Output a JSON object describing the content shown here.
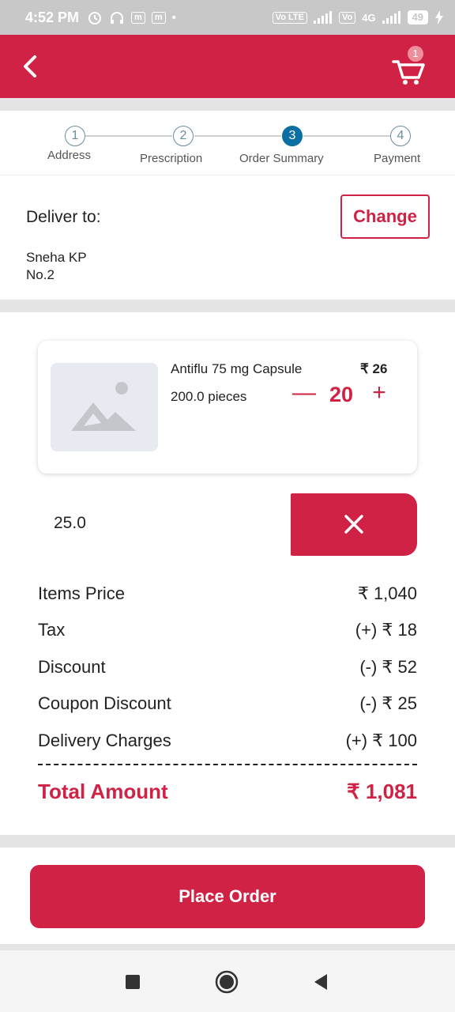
{
  "status_bar": {
    "time": "4:52 PM",
    "battery": "49",
    "network": "4G",
    "sim_label": "Vo LTE"
  },
  "app_bar": {
    "cart_count": "1",
    "accent_color": "#cf2244"
  },
  "stepper": {
    "steps": [
      {
        "number": "1",
        "label": "Address"
      },
      {
        "number": "2",
        "label": "Prescription"
      },
      {
        "number": "3",
        "label": "Order Summary"
      },
      {
        "number": "4",
        "label": "Payment"
      }
    ],
    "active_step": "3",
    "active_color": "#0b6fa2"
  },
  "delivery": {
    "title": "Deliver to:",
    "change_label": "Change",
    "name": "Sneha KP",
    "address_line": "No.2"
  },
  "product": {
    "name": "Antiflu 75 mg Capsule",
    "price": "₹ 26",
    "pack": "200.0 pieces",
    "quantity": "20",
    "minus_label": "—",
    "plus_label": "+"
  },
  "coupon": {
    "value": "25.0"
  },
  "summary": {
    "rows": [
      {
        "label": "Items Price",
        "value": "₹ 1,040"
      },
      {
        "label": "Tax",
        "value": "(+) ₹ 18"
      },
      {
        "label": "Discount",
        "value": "(-) ₹ 52"
      },
      {
        "label": "Coupon Discount",
        "value": "(-) ₹ 25"
      },
      {
        "label": "Delivery Charges",
        "value": "(+) ₹ 100"
      }
    ],
    "total_label": "Total Amount",
    "total_value": "₹ 1,081"
  },
  "actions": {
    "place_order_label": "Place Order"
  }
}
